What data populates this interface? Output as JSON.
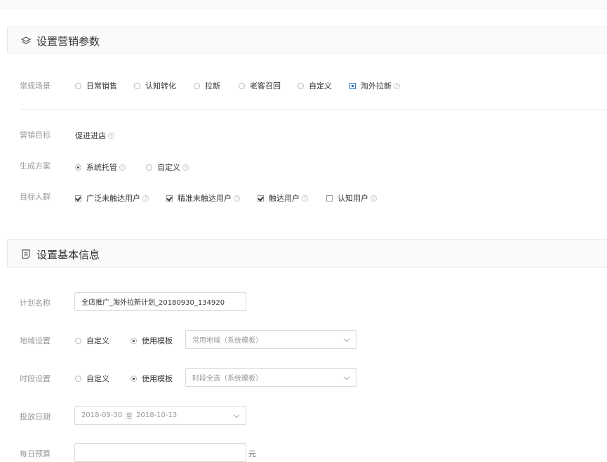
{
  "marketing": {
    "title": "设置营销参数",
    "scene": {
      "label": "常规场景",
      "options": [
        {
          "label": "日常销售",
          "selected": false
        },
        {
          "label": "认知转化",
          "selected": false
        },
        {
          "label": "拉新",
          "selected": false
        },
        {
          "label": "老客召回",
          "selected": false
        },
        {
          "label": "自定义",
          "selected": false
        },
        {
          "label": "淘外拉新",
          "selected": true
        }
      ]
    },
    "goal": {
      "label": "营销目标",
      "value": "促进进店"
    },
    "plan": {
      "label": "生成方案",
      "options": [
        {
          "label": "系统托管",
          "selected": true
        },
        {
          "label": "自定义",
          "selected": false
        }
      ]
    },
    "audience": {
      "label": "目标人群",
      "options": [
        {
          "label": "广泛未触达用户",
          "checked": true
        },
        {
          "label": "精准未触达用户",
          "checked": true
        },
        {
          "label": "触达用户",
          "checked": true
        },
        {
          "label": "认知用户",
          "checked": false
        }
      ]
    },
    "help": "?"
  },
  "basic": {
    "title": "设置基本信息",
    "name": {
      "label": "计划名称",
      "value": "全店推广_淘外拉新计划_20180930_134920"
    },
    "region": {
      "label": "地域设置",
      "opt_custom": "自定义",
      "opt_template": "使用模板",
      "template_value": "常用地域（系统模板）"
    },
    "time": {
      "label": "时段设置",
      "opt_custom": "自定义",
      "opt_template": "使用模板",
      "template_value": "时段全选（系统模板）"
    },
    "date": {
      "label": "投放日期",
      "start": "2018-09-30",
      "sep": "至",
      "end": "2018-10-13"
    },
    "budget": {
      "label": "每日预算",
      "value": "",
      "unit": "元"
    }
  }
}
